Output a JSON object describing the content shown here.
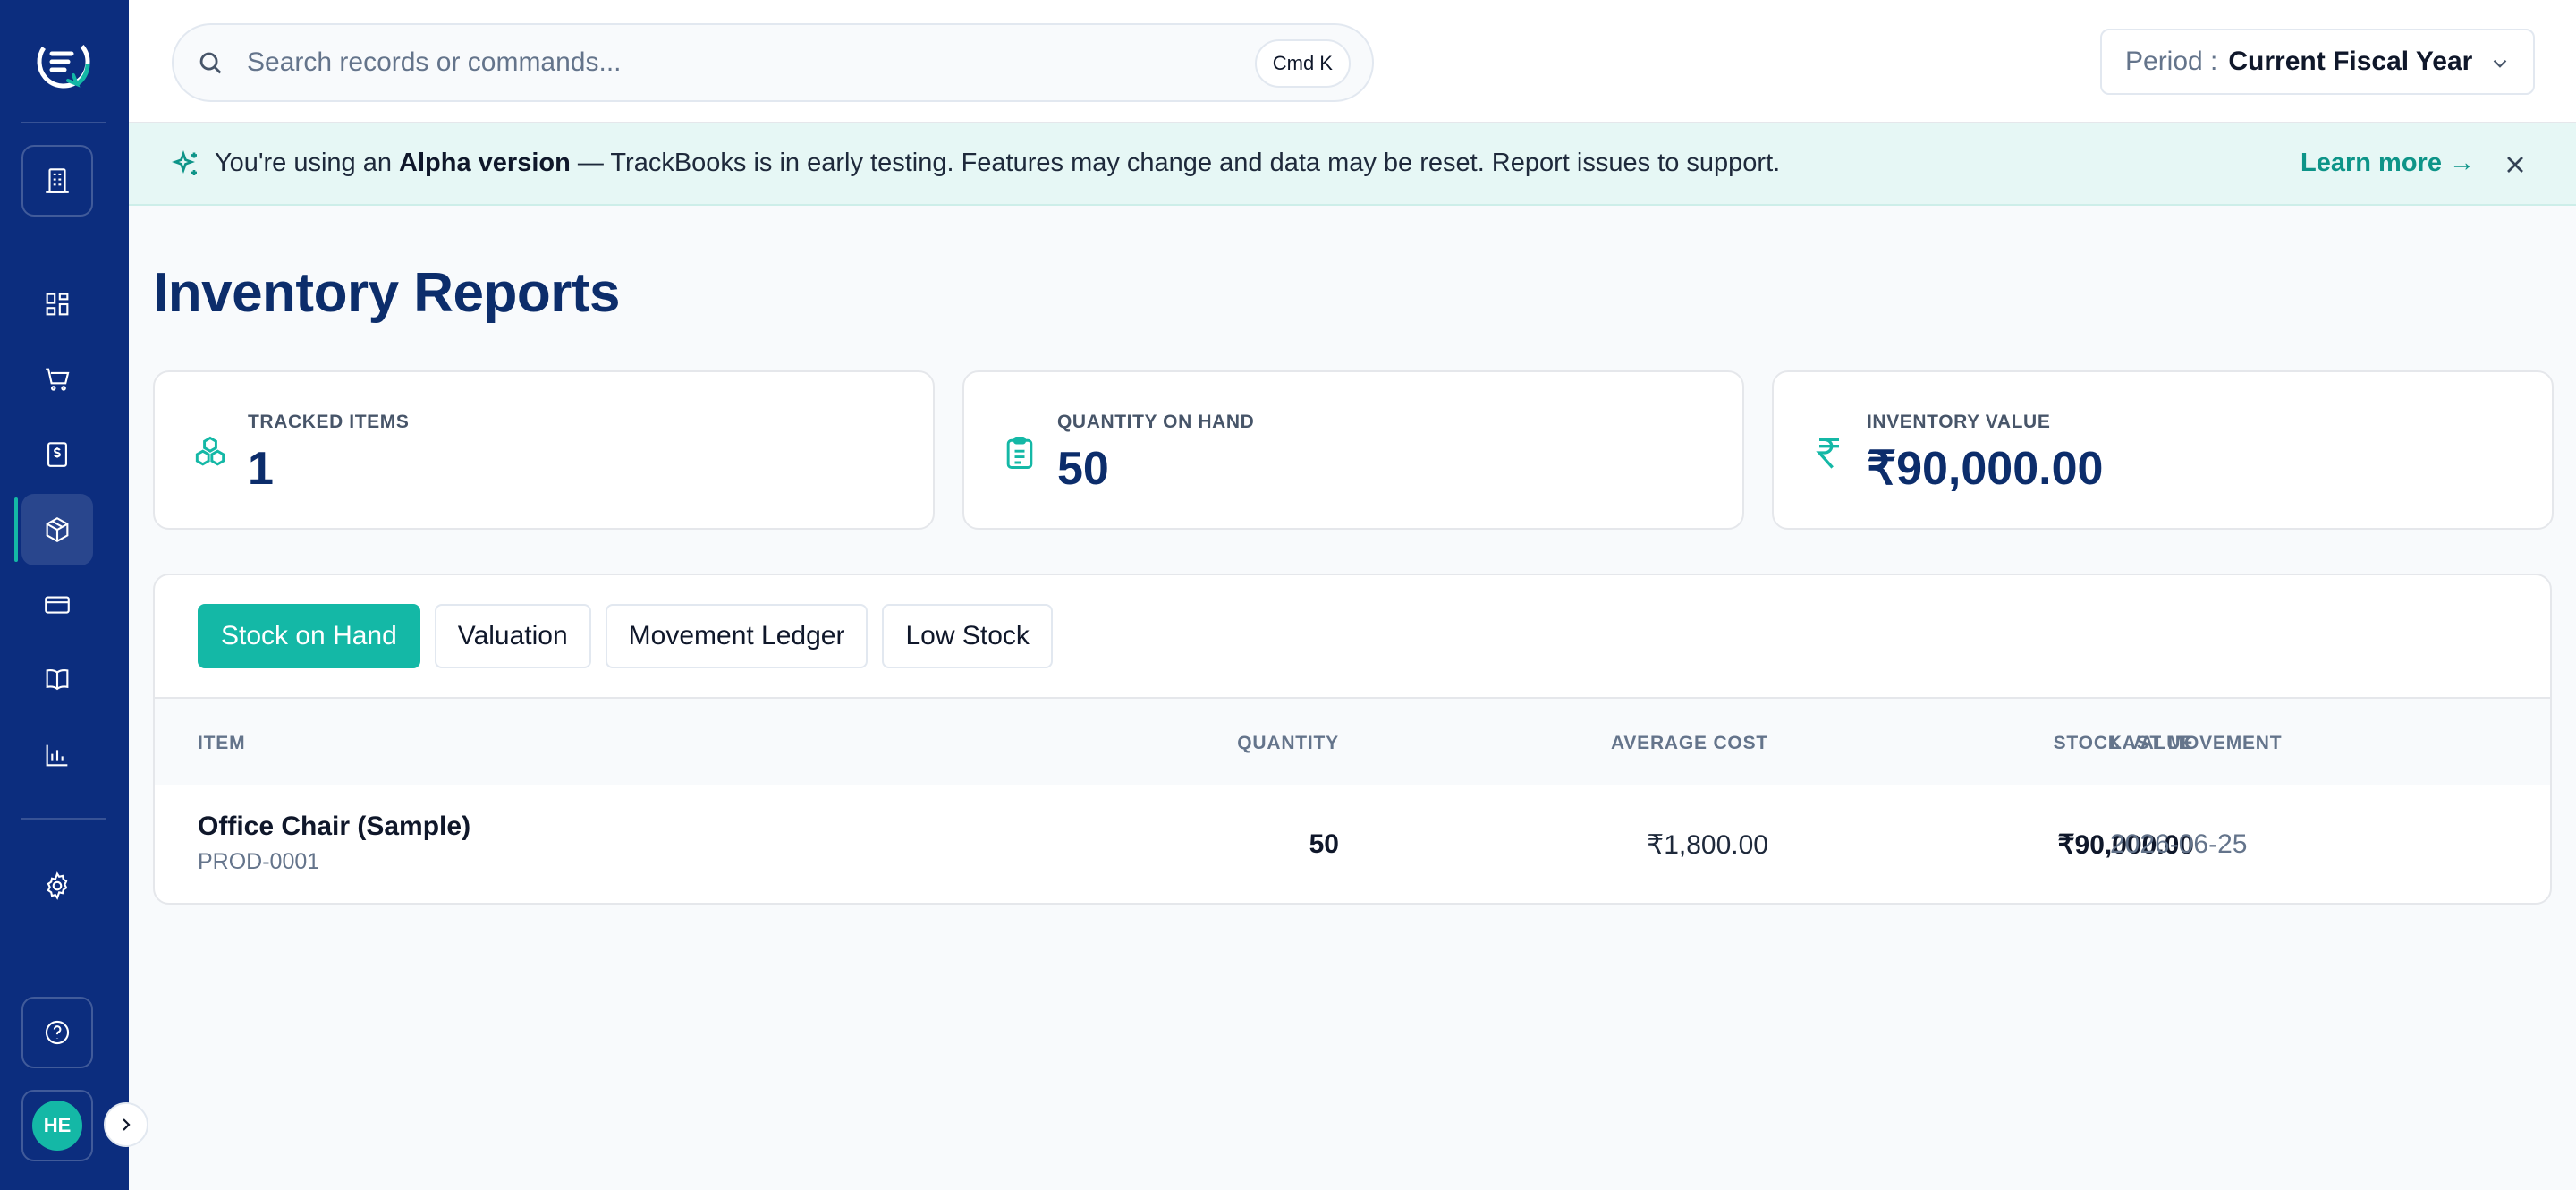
{
  "sidebar": {
    "user_initials": "HE"
  },
  "search": {
    "placeholder": "Search records or commands...",
    "shortcut": "Cmd K"
  },
  "period": {
    "label": "Period :",
    "value": "Current Fiscal Year"
  },
  "banner": {
    "prefix": "You're using an ",
    "emphasis": "Alpha version",
    "message": " — TrackBooks is in early testing. Features may change and data may be reset. Report issues to support.",
    "link": "Learn more →"
  },
  "page": {
    "title": "Inventory Reports"
  },
  "stats": [
    {
      "label": "TRACKED ITEMS",
      "value": "1"
    },
    {
      "label": "QUANTITY ON HAND",
      "value": "50"
    },
    {
      "label": "INVENTORY VALUE",
      "value": "₹90,000.00"
    }
  ],
  "tabs": [
    {
      "label": "Stock on Hand",
      "active": true
    },
    {
      "label": "Valuation",
      "active": false
    },
    {
      "label": "Movement Ledger",
      "active": false
    },
    {
      "label": "Low Stock",
      "active": false
    }
  ],
  "table": {
    "columns": [
      "ITEM",
      "QUANTITY",
      "AVERAGE COST",
      "STOCK VALUE",
      "LAST MOVEMENT"
    ],
    "rows": [
      {
        "name": "Office Chair (Sample)",
        "code": "PROD-0001",
        "quantity": "50",
        "average_cost": "₹1,800.00",
        "stock_value": "₹90,000.00",
        "last_movement": "2026-06-25"
      }
    ]
  },
  "colors": {
    "sidebar": "#0c2d7e",
    "accent": "#14b8a6",
    "title": "#0c2d6b"
  }
}
